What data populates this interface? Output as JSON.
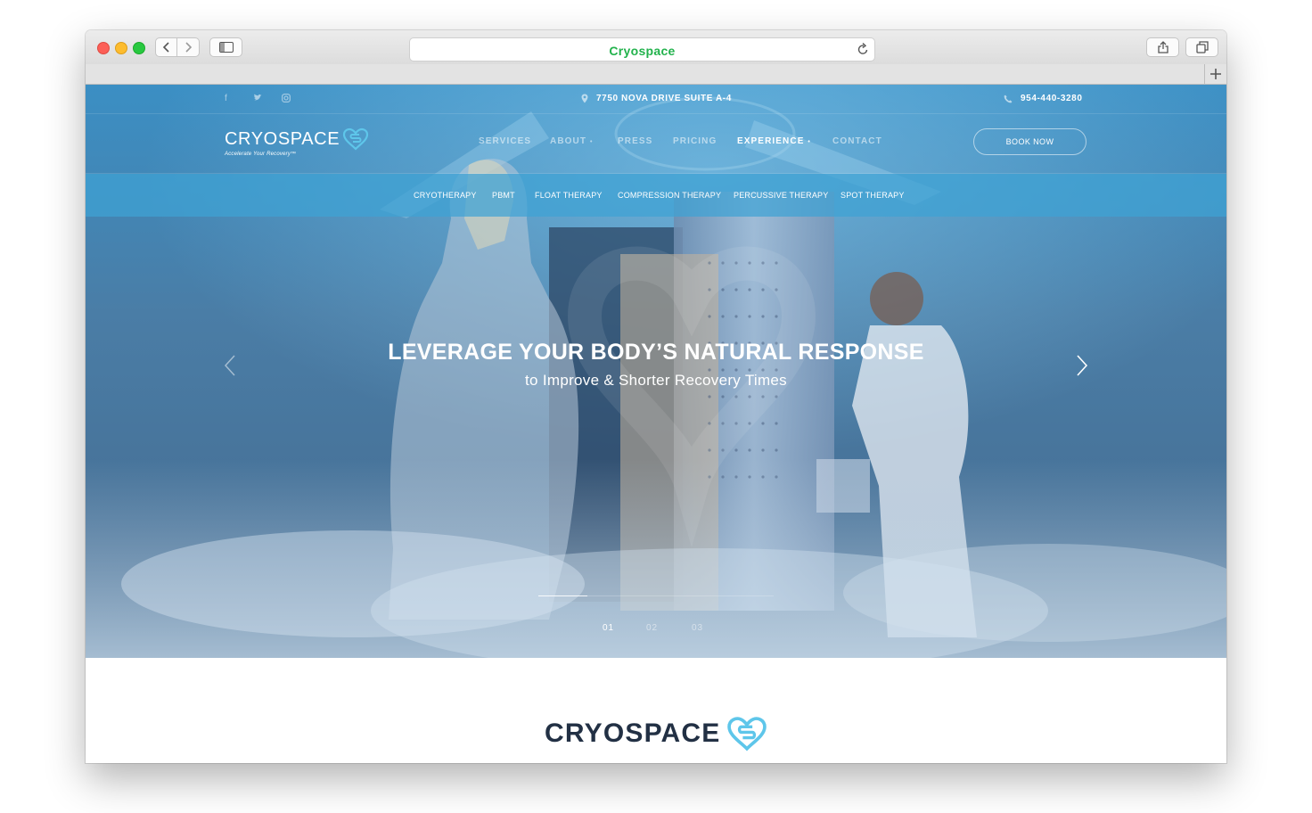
{
  "browser": {
    "address": "Cryospace"
  },
  "topbar": {
    "social_icons": [
      "facebook-icon",
      "twitter-icon",
      "instagram-icon"
    ],
    "address": "7750 NOVA DRIVE SUITE A-4",
    "phone": "954-440-3280"
  },
  "nav": {
    "logo": "CRYOSPACE",
    "tagline": "Accelerate Your Recovery™",
    "items": [
      {
        "label": "SERVICES"
      },
      {
        "label": "ABOUT",
        "caret": "•"
      },
      {
        "label": "PRESS"
      },
      {
        "label": "PRICING"
      },
      {
        "label": "EXPERIENCE",
        "caret": "•"
      },
      {
        "label": "CONTACT"
      }
    ],
    "active_item": "EXPERIENCE",
    "book_button": "BOOK NOW"
  },
  "subnav": {
    "items": [
      "CRYOTHERAPY",
      "PBMT",
      "FLOAT THERAPY",
      "COMPRESSION THERAPY",
      "PERCUSSIVE THERAPY",
      "SPOT THERAPY"
    ]
  },
  "hero": {
    "headline": "LEVERAGE YOUR BODY’S NATURAL RESPONSE",
    "subheadline": "to Improve & Shorter Recovery Times",
    "slides": [
      "01",
      "02",
      "03"
    ],
    "active_slide": "01",
    "progress": 0.21
  },
  "footer_logo": "CRYOSPACE",
  "colors": {
    "accent_green": "#22b24c",
    "brand_blue": "#3fa2d4",
    "logo_navy": "#223044",
    "heart_blue": "#5ec6ea"
  }
}
